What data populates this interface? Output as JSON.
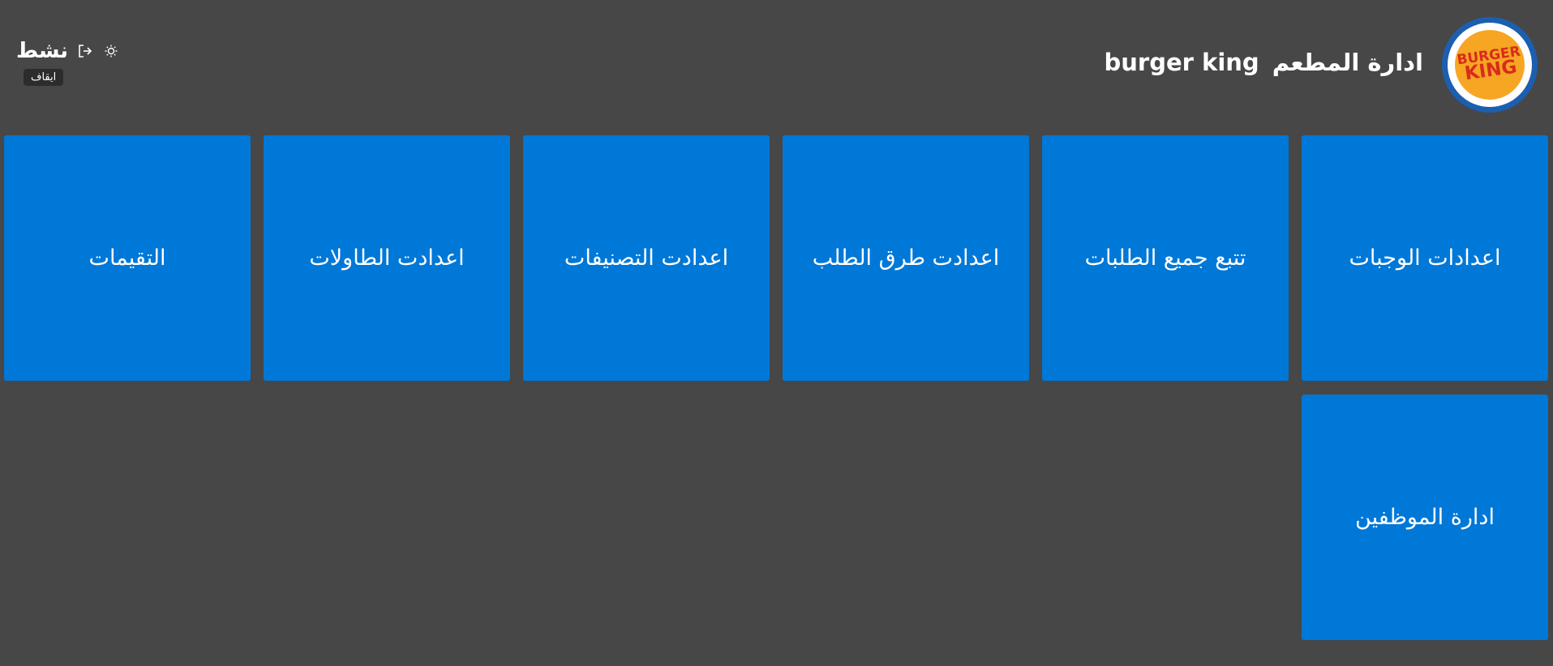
{
  "header": {
    "title_main": "ادارة المطعم",
    "title_brand": "burger king",
    "logo_text_line1": "BURGER",
    "logo_text_line2": "KING"
  },
  "status": {
    "text": "نشط",
    "tooltip": "ايقاف",
    "logout_icon": "logout-icon",
    "theme_icon": "sun-icon"
  },
  "tiles": [
    {
      "label": "اعدادات الوجبات"
    },
    {
      "label": "تتبع جميع الطلبات"
    },
    {
      "label": "اعدادت طرق الطلب"
    },
    {
      "label": "اعدادت التصنيفات"
    },
    {
      "label": "اعدادت الطاولات"
    },
    {
      "label": "التقيمات"
    },
    {
      "label": "ادارة الموظفين"
    }
  ],
  "colors": {
    "background": "#474747",
    "tile": "#0078d7",
    "logo_blue": "#1c5fb0",
    "logo_orange": "#f6a623",
    "logo_red": "#d92b1b"
  }
}
